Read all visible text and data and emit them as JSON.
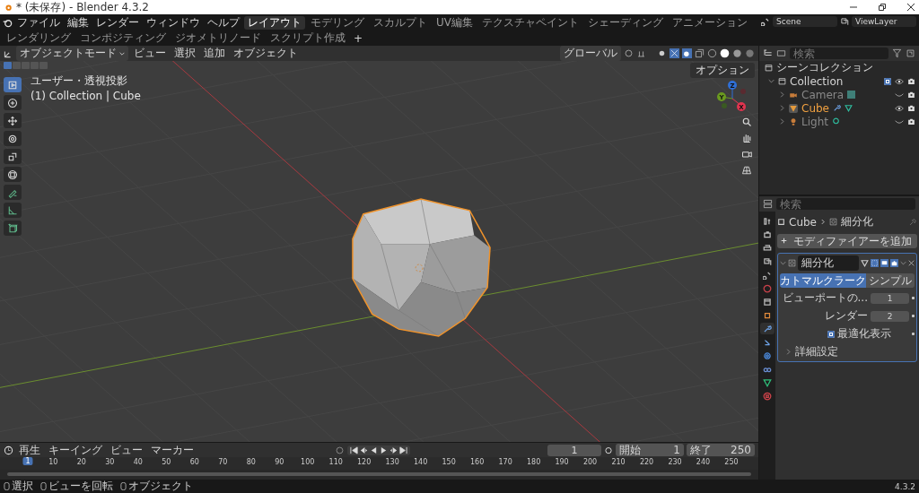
{
  "window": {
    "title": "* (未保存) - Blender 4.3.2"
  },
  "menu": [
    "ファイル",
    "編集",
    "レンダー",
    "ウィンドウ",
    "ヘルプ"
  ],
  "workspaces": [
    {
      "label": "レイアウト",
      "selected": true
    },
    {
      "label": "モデリング",
      "selected": false
    },
    {
      "label": "スカルプト",
      "selected": false
    },
    {
      "label": "UV編集",
      "selected": false
    },
    {
      "label": "テクスチャペイント",
      "selected": false
    },
    {
      "label": "シェーディング",
      "selected": false
    },
    {
      "label": "アニメーション",
      "selected": false
    },
    {
      "label": "レンダリング",
      "selected": false
    },
    {
      "label": "コンポジティング",
      "selected": false
    },
    {
      "label": "ジオメトリノード",
      "selected": false
    },
    {
      "label": "スクリプト作成",
      "selected": false
    }
  ],
  "add_workspace": "+",
  "scene": "Scene",
  "view_layer": "ViewLayer",
  "viewport": {
    "mode": "オブジェクトモード",
    "menus": [
      "ビュー",
      "選択",
      "追加",
      "オブジェクト"
    ],
    "orientation": "グローバル",
    "view_name": "ユーザー・透視投影",
    "context": "(1) Collection | Cube",
    "options": "オプション",
    "select_modes": [
      {
        "selected": true
      },
      {
        "selected": false
      },
      {
        "selected": false
      },
      {
        "selected": false
      },
      {
        "selected": false
      }
    ],
    "tools": [
      {
        "kind": "select",
        "selected": true
      },
      {
        "kind": "cursor",
        "selected": false
      },
      {
        "kind": "move",
        "selected": false
      },
      {
        "kind": "rotate",
        "selected": false
      },
      {
        "kind": "scale",
        "selected": false
      },
      {
        "kind": "transform",
        "selected": false
      },
      {
        "kind": "annotate",
        "selected": false
      },
      {
        "kind": "measure",
        "selected": false
      },
      {
        "kind": "add-cube",
        "selected": false
      }
    ],
    "gizmo": [
      {
        "label": "Z",
        "color": "#2f6fd6"
      },
      {
        "label": "Y",
        "color": "#6a9a1f"
      },
      {
        "label": "X",
        "color": "#e0344f"
      }
    ]
  },
  "outliner": {
    "search_placeholder": "検索",
    "root": "シーンコレクション",
    "collections": [
      {
        "name": "Collection",
        "checked": true,
        "expanded": true,
        "children": [
          {
            "name": "Camera",
            "kind": "camera",
            "visible": false,
            "selected": false
          },
          {
            "name": "Cube",
            "kind": "mesh",
            "visible": true,
            "selected": true
          },
          {
            "name": "Light",
            "kind": "light",
            "visible": false,
            "selected": false
          }
        ]
      }
    ]
  },
  "properties": {
    "search_placeholder": "検索",
    "object": "Cube",
    "modifier_crumb": "細分化",
    "add_modifier": "モディファイアーを追加",
    "tabs": [
      {
        "kind": "tool",
        "selected": false
      },
      {
        "kind": "render",
        "selected": false
      },
      {
        "kind": "output",
        "selected": false
      },
      {
        "kind": "view-layer",
        "selected": false
      },
      {
        "kind": "scene",
        "selected": false
      },
      {
        "kind": "world",
        "selected": false
      },
      {
        "kind": "collection",
        "selected": false
      },
      {
        "kind": "object",
        "selected": false
      },
      {
        "kind": "modifier",
        "selected": true
      },
      {
        "kind": "particles",
        "selected": false
      },
      {
        "kind": "physics",
        "selected": false
      },
      {
        "kind": "constraints",
        "selected": false
      },
      {
        "kind": "data",
        "selected": false
      },
      {
        "kind": "material",
        "selected": false
      }
    ],
    "modifier": {
      "name": "細分化",
      "expanded": true,
      "methods": [
        {
          "label": "カトマルクラーク",
          "selected": true
        },
        {
          "label": "シンプル",
          "selected": false
        }
      ],
      "fields": [
        {
          "label": "ビューポートの...",
          "value": "1"
        },
        {
          "label": "レンダー",
          "value": "2"
        }
      ],
      "optimal": {
        "label": "最適化表示",
        "checked": true
      },
      "advanced": {
        "label": "詳細設定",
        "expanded": false
      }
    }
  },
  "timeline": {
    "menus": [
      "再生",
      "キーイング",
      "ビュー",
      "マーカー"
    ],
    "current_frame": "1",
    "start_label": "開始",
    "start": "1",
    "end_label": "終了",
    "end": "250",
    "playhead": "1",
    "ticks": [
      "10",
      "20",
      "30",
      "40",
      "50",
      "60",
      "70",
      "80",
      "90",
      "100",
      "110",
      "120",
      "130",
      "140",
      "150",
      "160",
      "170",
      "180",
      "190",
      "200",
      "210",
      "220",
      "230",
      "240",
      "250"
    ]
  },
  "status_bar": {
    "items": [
      "選択",
      "ビューを回転",
      "オブジェクト"
    ],
    "version": "4.3.2"
  }
}
